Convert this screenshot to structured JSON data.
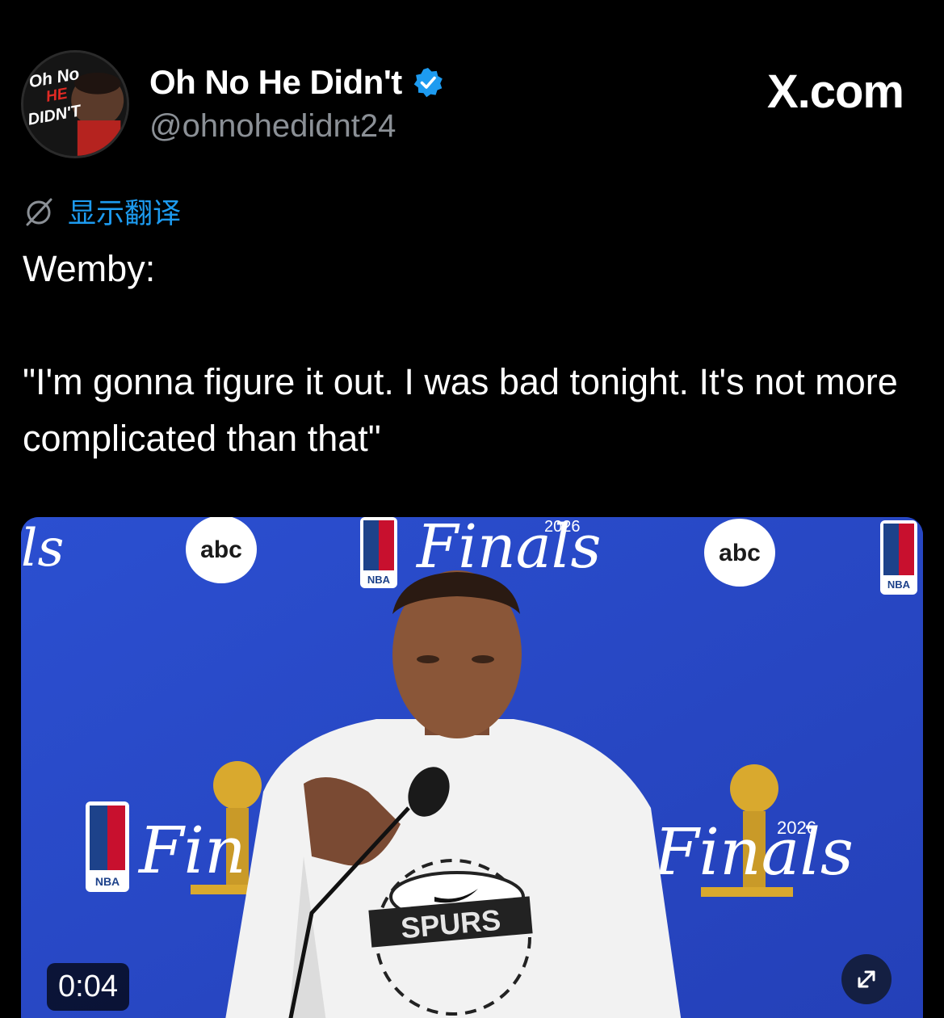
{
  "author": {
    "display_name": "Oh No He Didn't",
    "handle": "@ohnohedidnt24",
    "avatar_text": [
      "Oh No",
      "HE",
      "DIDN'T"
    ],
    "verified_color": "#1d9bf0"
  },
  "site_label": "X.com",
  "translate": {
    "icon": "globe-slash-icon",
    "label": "显示翻译"
  },
  "tweet": {
    "text": "Wemby:\n\n\"I'm gonna figure it out. I was bad tonight. It's not more complicated than that\""
  },
  "media": {
    "duration": "0:04",
    "backdrop_color": "#2747c6",
    "backdrop_text": {
      "finals": "Finals",
      "year": "2026",
      "network": "abc",
      "league": "NBA",
      "partial_left": "ls",
      "partial_mid": "Fin"
    },
    "shirt_text": "SPURS",
    "expand_icon": "expand-arrows-icon"
  },
  "colors": {
    "background": "#000000",
    "link": "#1d9bf0",
    "handle": "#8b9096"
  }
}
